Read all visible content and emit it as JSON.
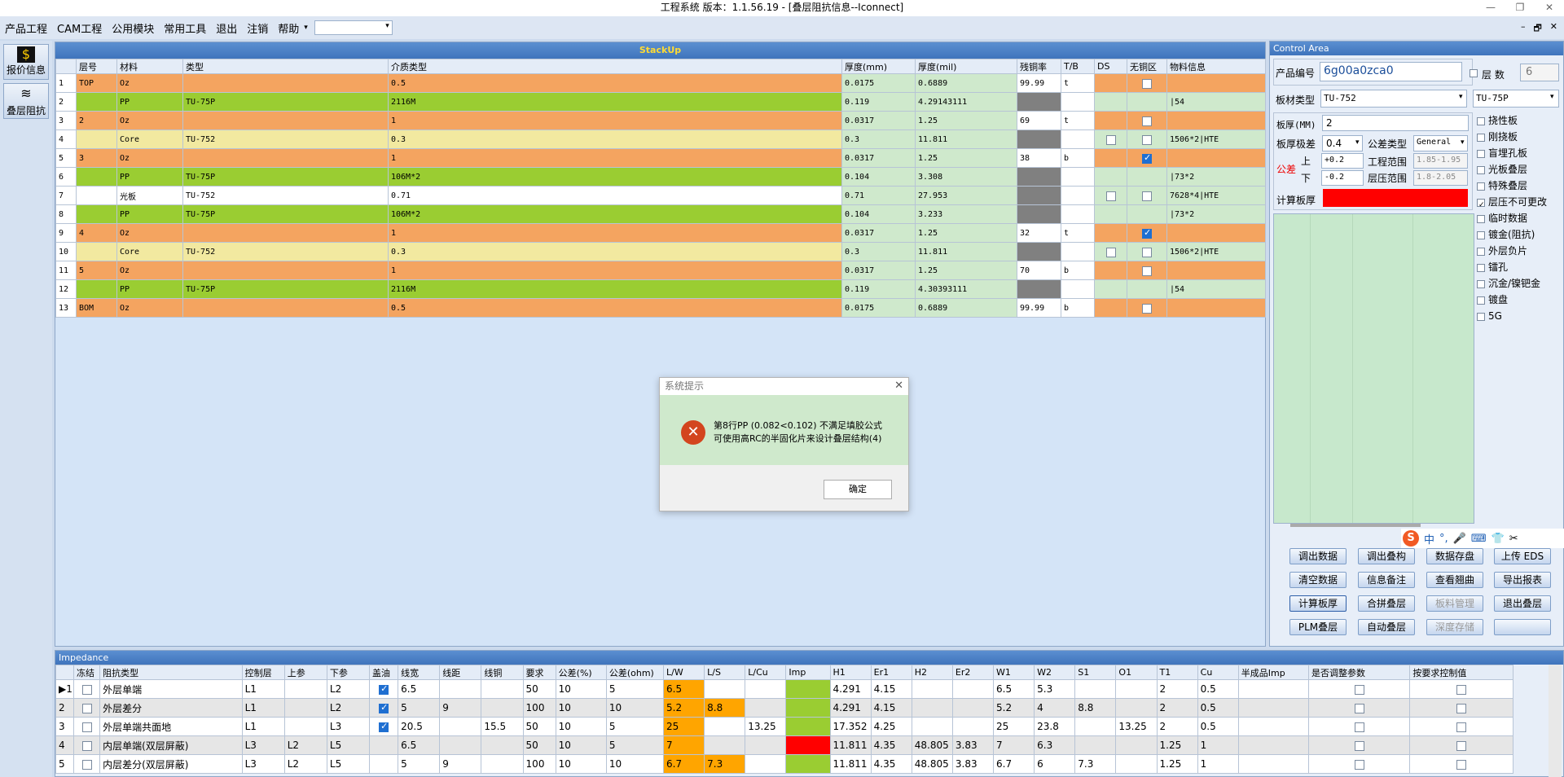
{
  "window": {
    "title": "工程系统  版本：1.1.56.19 - [叠层阻抗信息--Iconnect]",
    "controls": [
      "—",
      "❐",
      "✕"
    ]
  },
  "menu": {
    "items": [
      "产品工程",
      "CAM工程",
      "公用模块",
      "常用工具",
      "退出",
      "注销",
      "帮助"
    ],
    "more": "▾",
    "combo_value": "",
    "mdi_controls": [
      "–",
      "🗗",
      "✕"
    ]
  },
  "toolbar": {
    "items": [
      {
        "label": "报价信息",
        "icon": "$"
      },
      {
        "label": "叠层阻抗",
        "icon": "≋"
      }
    ]
  },
  "stackup": {
    "title": "StackUp",
    "columns": [
      "",
      "层号",
      "材料",
      "类型",
      "介质类型",
      "厚度(mm)",
      "厚度(mil)",
      "残铜率",
      "T/B",
      "DS",
      "无铜区",
      "物料信息"
    ],
    "rows": [
      {
        "n": "1",
        "layer": "TOP",
        "mat": "Oz",
        "type": "",
        "diel": "0.5",
        "mm": "0.0175",
        "mil": "0.6889",
        "cu": "99.99",
        "tb": "t",
        "ds": "",
        "nocu": "off",
        "info": "",
        "color": "orange"
      },
      {
        "n": "2",
        "layer": "",
        "mat": "PP",
        "type": "TU-75P",
        "diel": "2116M",
        "mm": "0.119",
        "mil": "4.29143111",
        "cu": "",
        "tb": "",
        "ds": "",
        "nocu": "",
        "info": "|54",
        "color": "green"
      },
      {
        "n": "3",
        "layer": "2",
        "mat": "Oz",
        "type": "",
        "diel": "1",
        "mm": "0.0317",
        "mil": "1.25",
        "cu": "69",
        "tb": "t",
        "ds": "",
        "nocu": "off",
        "info": "",
        "color": "orange"
      },
      {
        "n": "4",
        "layer": "",
        "mat": "Core",
        "type": "TU-752",
        "diel": "0.3",
        "mm": "0.3",
        "mil": "11.811",
        "cu": "",
        "tb": "",
        "ds": "off",
        "nocu": "off",
        "info": "1506*2|HTE",
        "color": "yellow"
      },
      {
        "n": "5",
        "layer": "3",
        "mat": "Oz",
        "type": "",
        "diel": "1",
        "mm": "0.0317",
        "mil": "1.25",
        "cu": "38",
        "tb": "b",
        "ds": "",
        "nocu": "on",
        "info": "",
        "color": "orange"
      },
      {
        "n": "6",
        "layer": "",
        "mat": "PP",
        "type": "TU-75P",
        "diel": "106M*2",
        "mm": "0.104",
        "mil": "3.308",
        "cu": "",
        "tb": "",
        "ds": "",
        "nocu": "",
        "info": "|73*2",
        "color": "green"
      },
      {
        "n": "7",
        "layer": "",
        "mat": "光板",
        "type": "TU-752",
        "diel": "0.71",
        "mm": "0.71",
        "mil": "27.953",
        "cu": "",
        "tb": "",
        "ds": "off",
        "nocu": "off",
        "info": "7628*4|HTE",
        "color": "white"
      },
      {
        "n": "8",
        "layer": "",
        "mat": "PP",
        "type": "TU-75P",
        "diel": "106M*2",
        "mm": "0.104",
        "mil": "3.233",
        "cu": "",
        "tb": "",
        "ds": "",
        "nocu": "",
        "info": "|73*2",
        "color": "green"
      },
      {
        "n": "9",
        "layer": "4",
        "mat": "Oz",
        "type": "",
        "diel": "1",
        "mm": "0.0317",
        "mil": "1.25",
        "cu": "32",
        "tb": "t",
        "ds": "",
        "nocu": "on",
        "info": "",
        "color": "orange"
      },
      {
        "n": "10",
        "layer": "",
        "mat": "Core",
        "type": "TU-752",
        "diel": "0.3",
        "mm": "0.3",
        "mil": "11.811",
        "cu": "",
        "tb": "",
        "ds": "off",
        "nocu": "off",
        "info": "1506*2|HTE",
        "color": "yellow"
      },
      {
        "n": "11",
        "layer": "5",
        "mat": "Oz",
        "type": "",
        "diel": "1",
        "mm": "0.0317",
        "mil": "1.25",
        "cu": "70",
        "tb": "b",
        "ds": "",
        "nocu": "off",
        "info": "",
        "color": "orange"
      },
      {
        "n": "12",
        "layer": "",
        "mat": "PP",
        "type": "TU-75P",
        "diel": "2116M",
        "mm": "0.119",
        "mil": "4.30393111",
        "cu": "",
        "tb": "",
        "ds": "",
        "nocu": "",
        "info": "|54",
        "color": "green"
      },
      {
        "n": "13",
        "layer": "BOM",
        "mat": "Oz",
        "type": "",
        "diel": "0.5",
        "mm": "0.0175",
        "mil": "0.6889",
        "cu": "99.99",
        "tb": "b",
        "ds": "",
        "nocu": "off",
        "info": "",
        "color": "orange"
      }
    ]
  },
  "control": {
    "title": "Control Area",
    "product_label": "产品编号",
    "product_value": "6g00a0zca0",
    "layers_label": "层 数",
    "layers_value": "6",
    "board_type_label": "板材类型",
    "board_type_value": "TU-752",
    "board_type2": "TU-75P",
    "thickness_label": "板厚(MM)",
    "thickness_value": "2",
    "extreme_label": "板厚极差",
    "extreme_value": "0.4",
    "tol_type_label": "公差类型",
    "tol_type_value": "General",
    "tol_label": "公差",
    "up_label": "上",
    "down_label": "下",
    "up_value": "+0.2",
    "down_value": "-0.2",
    "eng_range_label": "工程范围",
    "eng_range": "1.85-1.95",
    "press_range_label": "层压范围",
    "press_range": "1.8-2.05",
    "calc_label": "计算板厚",
    "options": [
      {
        "label": "挠性板",
        "on": false
      },
      {
        "label": "刚挠板",
        "on": false
      },
      {
        "label": "盲埋孔板",
        "on": false
      },
      {
        "label": "光板叠层",
        "on": false
      },
      {
        "label": "特殊叠层",
        "on": false
      },
      {
        "label": "层压不可更改",
        "on": true
      },
      {
        "label": "临时数据",
        "on": false
      },
      {
        "label": "镀金(阻抗)",
        "on": false
      },
      {
        "label": "外层负片",
        "on": false
      },
      {
        "label": "镭孔",
        "on": false
      },
      {
        "label": "沉金/镍钯金",
        "on": false
      },
      {
        "label": "镀盘",
        "on": false
      },
      {
        "label": "5G",
        "on": false
      }
    ],
    "buttons": [
      "调出数据",
      "调出叠构",
      "数据存盘",
      "上传 EDS",
      "清空数据",
      "信息备注",
      "查看翘曲",
      "导出报表",
      "计算板厚",
      "合拼叠层",
      "板料管理",
      "退出叠层",
      "PLM叠层",
      "自动叠层",
      "深度存储",
      ""
    ],
    "ime": [
      "S",
      "中",
      "°,",
      "🎤",
      "⌨",
      "👕",
      "✂"
    ]
  },
  "impedance": {
    "title": "Impedance",
    "columns": [
      "",
      "冻结",
      "阻抗类型",
      "控制层",
      "上参",
      "下参",
      "盖油",
      "线宽",
      "线距",
      "线铜",
      "要求",
      "公差(%)",
      "公差(ohm)",
      "L/W",
      "L/S",
      "L/Cu",
      "Imp",
      "H1",
      "Er1",
      "H2",
      "Er2",
      "W1",
      "W2",
      "S1",
      "O1",
      "T1",
      "Cu",
      "半成品Imp",
      "是否调整参数",
      "按要求控制值"
    ],
    "rows": [
      {
        "n": "▶1",
        "name": "外层单端",
        "ctl": "L1",
        "up": "",
        "down": "L2",
        "oil": true,
        "w": "6.5",
        "s": "",
        "cu": "",
        "req": "50",
        "tp": "10",
        "to": "5",
        "lw": "6.5",
        "ls": "",
        "lcu": "",
        "imp": "green",
        "h1": "4.291",
        "er1": "4.15",
        "h2": "",
        "er2": "",
        "w1": "6.5",
        "w2": "5.3",
        "s1": "",
        "o1": "",
        "t1": "2",
        "c": "0.5",
        "half": ""
      },
      {
        "n": "2",
        "name": "外层差分",
        "ctl": "L1",
        "up": "",
        "down": "L2",
        "oil": true,
        "w": "5",
        "s": "9",
        "cu": "",
        "req": "100",
        "tp": "10",
        "to": "10",
        "lw": "5.2",
        "ls": "8.8",
        "lcu": "",
        "imp": "green",
        "h1": "4.291",
        "er1": "4.15",
        "h2": "",
        "er2": "",
        "w1": "5.2",
        "w2": "4",
        "s1": "8.8",
        "o1": "",
        "t1": "2",
        "c": "0.5",
        "half": ""
      },
      {
        "n": "3",
        "name": "外层单端共面地",
        "ctl": "L1",
        "up": "",
        "down": "L3",
        "oil": true,
        "w": "20.5",
        "s": "",
        "cu": "15.5",
        "req": "50",
        "tp": "10",
        "to": "5",
        "lw": "25",
        "ls": "",
        "lcu": "13.25",
        "imp": "green",
        "h1": "17.352",
        "er1": "4.25",
        "h2": "",
        "er2": "",
        "w1": "25",
        "w2": "23.8",
        "s1": "",
        "o1": "13.25",
        "t1": "2",
        "c": "0.5",
        "half": ""
      },
      {
        "n": "4",
        "name": "内层单端(双层屏蔽)",
        "ctl": "L3",
        "up": "L2",
        "down": "L5",
        "oil": false,
        "w": "6.5",
        "s": "",
        "cu": "",
        "req": "50",
        "tp": "10",
        "to": "5",
        "lw": "7",
        "ls": "",
        "lcu": "",
        "imp": "red",
        "h1": "11.811",
        "er1": "4.35",
        "h2": "48.805",
        "er2": "3.83",
        "w1": "7",
        "w2": "6.3",
        "s1": "",
        "o1": "",
        "t1": "1.25",
        "c": "1",
        "half": ""
      },
      {
        "n": "5",
        "name": "内层差分(双层屏蔽)",
        "ctl": "L3",
        "up": "L2",
        "down": "L5",
        "oil": false,
        "w": "5",
        "s": "9",
        "cu": "",
        "req": "100",
        "tp": "10",
        "to": "10",
        "lw": "6.7",
        "ls": "7.3",
        "lcu": "",
        "imp": "green",
        "h1": "11.811",
        "er1": "4.35",
        "h2": "48.805",
        "er2": "3.83",
        "w1": "6.7",
        "w2": "6",
        "s1": "7.3",
        "o1": "",
        "t1": "1.25",
        "c": "1",
        "half": ""
      }
    ]
  },
  "dialog": {
    "title": "系统提示",
    "close": "✕",
    "icon": "✕",
    "line1": "第8行PP (0.082<0.102) 不满足填胶公式",
    "line2": "可使用高RC的半固化片来设计叠层结构(4)",
    "ok": "确定"
  },
  "colors": {
    "orange": "#f4a460",
    "green": "#9acd32",
    "yellow": "#f2e9a0",
    "white": "#ffffff",
    "grey": "#808080",
    "red": "#ff0000",
    "lightgreen": "#cfe9cc"
  }
}
